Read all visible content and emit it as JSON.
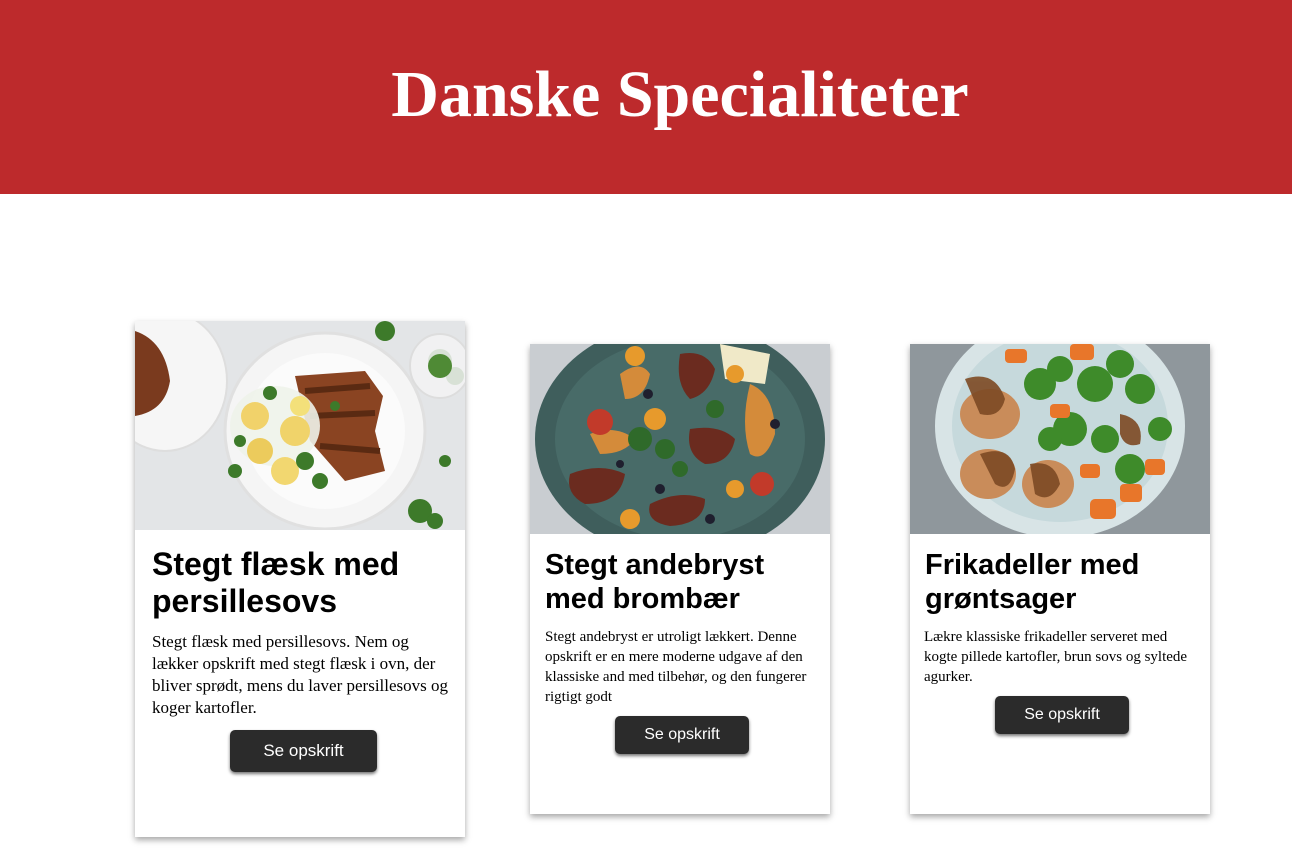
{
  "header": {
    "title": "Danske Specialiteter"
  },
  "cards": [
    {
      "title": "Stegt flæsk med persillesovs",
      "description": "Stegt flæsk med persillesovs. Nem og lækker opskrift med stegt flæsk i ovn, der bliver sprødt, mens du laver persillesovs og koger kartofler.",
      "button_label": "Se opskrift"
    },
    {
      "title": "Stegt andebryst med brombær",
      "description": "Stegt andebryst er utroligt lækkert. Denne opskrift er en mere moderne udgave af den klassiske and med tilbehør, og den fungerer rigtigt godt",
      "button_label": "Se opskrift"
    },
    {
      "title": "Frikadeller med grøntsager",
      "description": "Lækre klassiske frikadeller  serveret med kogte pillede kartofler, brun sovs og syltede agurker.",
      "button_label": "Se opskrift"
    }
  ],
  "colors": {
    "header_background": "#bd2a2c",
    "header_text": "#ffffff",
    "button_background": "#2b2b2b",
    "button_text": "#ffffff"
  }
}
